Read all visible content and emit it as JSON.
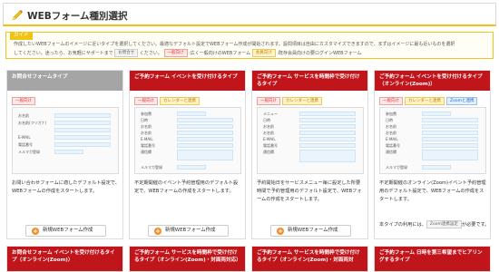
{
  "header": {
    "title": "WEBフォーム種別選択"
  },
  "guide": {
    "label": "ガイド",
    "line1": "作成したいWEBフォームのイメージに近いタイプを選択してください。最適なデフォルト設定でWEBフォーム作成が開始されます。設問項目は自由にカスタマイズできますので、まずはイメージに最も近いものを選択",
    "line2_a": "してください。迷ったら、お気軽にサポートまで",
    "line2_tag1": "お問合せ",
    "line2_b": "ください。",
    "line2_tag2": "一般向け",
    "line2_c": ":広く一般向けのWEBフォーム",
    "line2_tag3": "会員向け",
    "line2_d": ":既存会員向けの要ログインWEBフォーム"
  },
  "tags": {
    "general": "一般向け",
    "calendar": "カレンダーと連携",
    "zoom": "Zoomと連携"
  },
  "cards": [
    {
      "title": "お問合せフォームタイプ",
      "fields": [
        "お名前",
        "お名前(フリガナ)",
        "",
        "E-MAIL",
        "電話番号",
        "メルマガ登録"
      ],
      "desc": "お問い合わせフォームに適したデフォルト設定で、WEBフォームの作成をスタートします。",
      "button": "新規WEBフォーム作成"
    },
    {
      "title": "ご予約フォーム イベントを受け付けるタイプ",
      "fields": [
        "参加費",
        "日時",
        "お名前",
        "お名前",
        "E-MAIL",
        "電話番号",
        "通信欄",
        "",
        "メルマガ登録"
      ],
      "desc": "不定期開催のイベント予約管理用のデフォルト設定で、WEBフォームの作成をスタートします。",
      "button": "新規WEBフォーム作成"
    },
    {
      "title": "ご予約フォーム サービスを時間枠で受け付けるタイプ",
      "fields": [
        "メニュー",
        "日時",
        "お名前",
        "お名前",
        "E-MAIL",
        "電話番号",
        "通信欄"
      ],
      "desc": "予約開始日をサービスメニュー毎に設定した所要時間で予約管理用のデフォルト設定で、WEBフォームの作成をスタートします。",
      "button": "新規WEBフォーム作成"
    },
    {
      "title": "ご予約フォーム イベントを受け付けるタイプ（オンライン(Zoom)）",
      "fields": [
        "参加費",
        "日時",
        "お名前",
        "お名前",
        "E-MAIL",
        "電話番号",
        "通信欄",
        "",
        "メルマガ登録"
      ],
      "desc": "不定期開催のオンライン(Zoom)イベント予約管理用のデフォルト設定で、WEBフォームの作成をスタートします。",
      "note_a": "本タイプの利用には、",
      "note_tag": "Zoom連携設定",
      "note_b": "が必要です。"
    }
  ],
  "bottom_cards": [
    "お問合せフォーム イベントを受け付けるタイプ（オンライン(Zoom)）",
    "ご予約フォーム サービスを時間枠で受け付けるタイプ（オンライン(Zoom)・対面両対応）",
    "ご予約フォーム サービスを時間枠で受け付けるタイプ（オンライン(Zoom)・対面両対",
    "ご予約フォーム 日時を第三希望までヒアリングするタイプ"
  ],
  "colors": {
    "accent_yellow": "#f0c414",
    "card_red": "#c0151b",
    "card_gray": "#a5a5a5",
    "button_orange": "#f28c28"
  }
}
